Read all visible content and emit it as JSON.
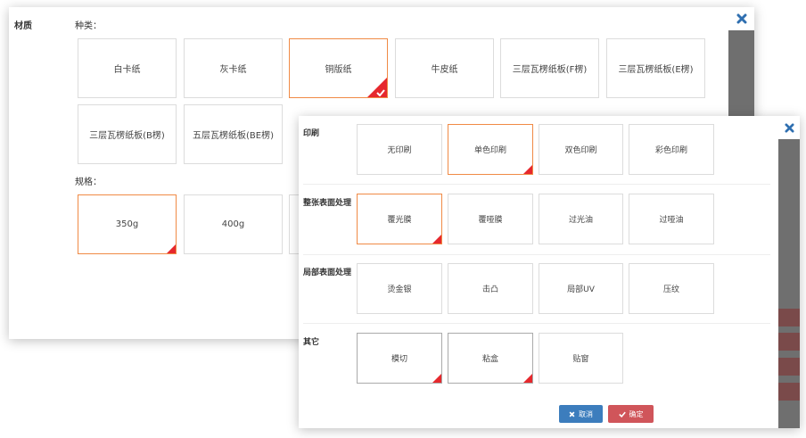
{
  "material_panel": {
    "title": "材质",
    "kind_label": "种类：",
    "spec_label": "规格：",
    "kinds": [
      "白卡纸",
      "灰卡纸",
      "铜版纸",
      "牛皮纸",
      "三层瓦楞纸板(F楞)",
      "三层瓦楞纸板(E楞)",
      "三层瓦楞纸板(B楞)",
      "五层瓦楞纸板(BE楞)"
    ],
    "kind_selected": "铜版纸",
    "specs": [
      "350g",
      "400g"
    ],
    "spec_selected": "350g"
  },
  "process_panel": {
    "groups": [
      {
        "label": "印刷",
        "options": [
          "无印刷",
          "单色印刷",
          "双色印刷",
          "彩色印刷"
        ],
        "selected": "单色印刷"
      },
      {
        "label": "整张表面处理",
        "options": [
          "覆光膜",
          "覆哑膜",
          "过光油",
          "过哑油"
        ],
        "selected": "覆光膜"
      },
      {
        "label": "局部表面处理",
        "options": [
          "烫金银",
          "击凸",
          "局部UV",
          "压纹"
        ],
        "selected": ""
      },
      {
        "label": "其它",
        "options": [
          "模切",
          "粘盒",
          "贴窗"
        ],
        "selected": "模切、粘盒"
      }
    ],
    "cancel_label": "取消",
    "ok_label": "确定"
  },
  "colors": {
    "accent_orange": "#f08a45",
    "check_red": "#e6282d",
    "close_blue": "#2f6fb0",
    "cancel_blue": "#3c7dbd",
    "ok_red": "#d0555a"
  },
  "icons": [
    "close-icon",
    "checkmark-icon"
  ]
}
